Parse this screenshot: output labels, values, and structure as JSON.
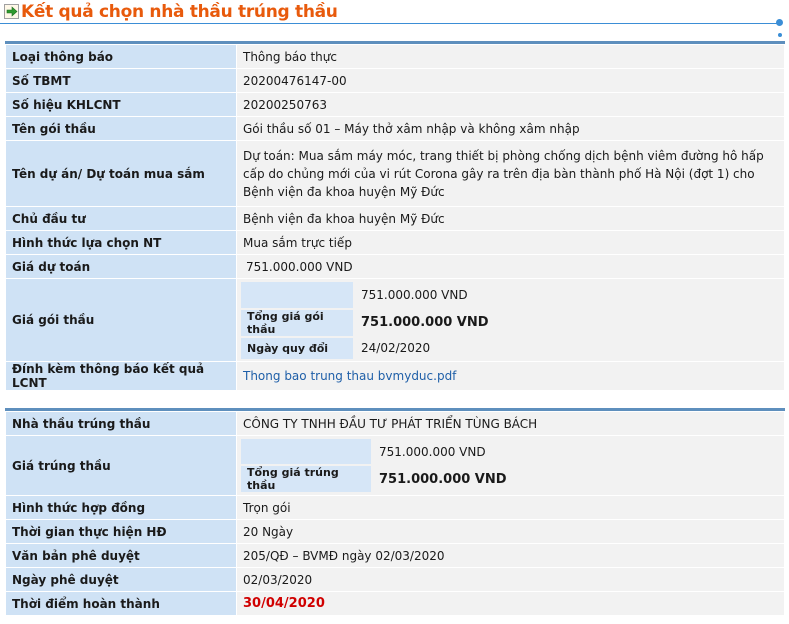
{
  "header": {
    "title": "Kết quả chọn nhà thầu trúng thầu",
    "icon": "arrow-right-icon",
    "accent_color": "#e85a0c",
    "rule_color": "#3b8ed6"
  },
  "section1": {
    "rows": [
      {
        "label": "Loại thông báo",
        "value": "Thông báo thực"
      },
      {
        "label": "Số TBMT",
        "value": "20200476147-00"
      },
      {
        "label": "Số hiệu KHLCNT",
        "value": "20200250763"
      },
      {
        "label": "Tên gói thầu",
        "value": "Gói thầu số 01 – Máy thở xâm nhập và không xâm nhập"
      },
      {
        "label": "Tên dự án/ Dự toán mua sắm",
        "value": "Dự toán: Mua sắm máy móc, trang thiết bị phòng chống dịch bệnh viêm đường hô hấp cấp do chủng mới của vi rút Corona gây ra trên địa bàn thành phố Hà Nội (đợt 1) cho Bệnh viện đa khoa huyện Mỹ Đức"
      },
      {
        "label": "Chủ đầu tư",
        "value": "Bệnh viện đa khoa huyện Mỹ Đức"
      },
      {
        "label": "Hình thức lựa chọn NT",
        "value": "Mua sắm trực tiếp"
      },
      {
        "label": "Giá dự toán",
        "value": "751.000.000 VND"
      }
    ],
    "package_price": {
      "label": "Giá gói thầu",
      "amount": "751.000.000  VND",
      "total_label": "Tổng giá gói thầu",
      "total_value": "751.000.000  VND",
      "date_label": "Ngày quy đổi",
      "date_value": "24/02/2020"
    },
    "attachment": {
      "label": "Đính kèm thông báo kết quả LCNT",
      "link": "Thong bao trung thau bvmyduc.pdf"
    }
  },
  "section2": {
    "winner": {
      "label": "Nhà thầu trúng thầu",
      "value": "CÔNG TY TNHH ĐẦU TƯ PHÁT TRIỂN TÙNG BÁCH"
    },
    "winning_price": {
      "label": "Giá trúng thầu",
      "amount": "751.000.000  VND",
      "total_label": "Tổng giá trúng thầu",
      "total_value": "751.000.000  VND"
    },
    "rows": [
      {
        "label": "Hình thức hợp đồng",
        "value": "Trọn gói"
      },
      {
        "label": "Thời gian thực hiện HĐ",
        "value": "20  Ngày"
      },
      {
        "label": "Văn bản phê duyệt",
        "value": "205/QĐ – BVMĐ ngày 02/03/2020"
      },
      {
        "label": "Ngày phê duyệt",
        "value": "02/03/2020"
      }
    ],
    "completion": {
      "label": "Thời điểm hoàn thành",
      "value": "30/04/2020"
    }
  }
}
